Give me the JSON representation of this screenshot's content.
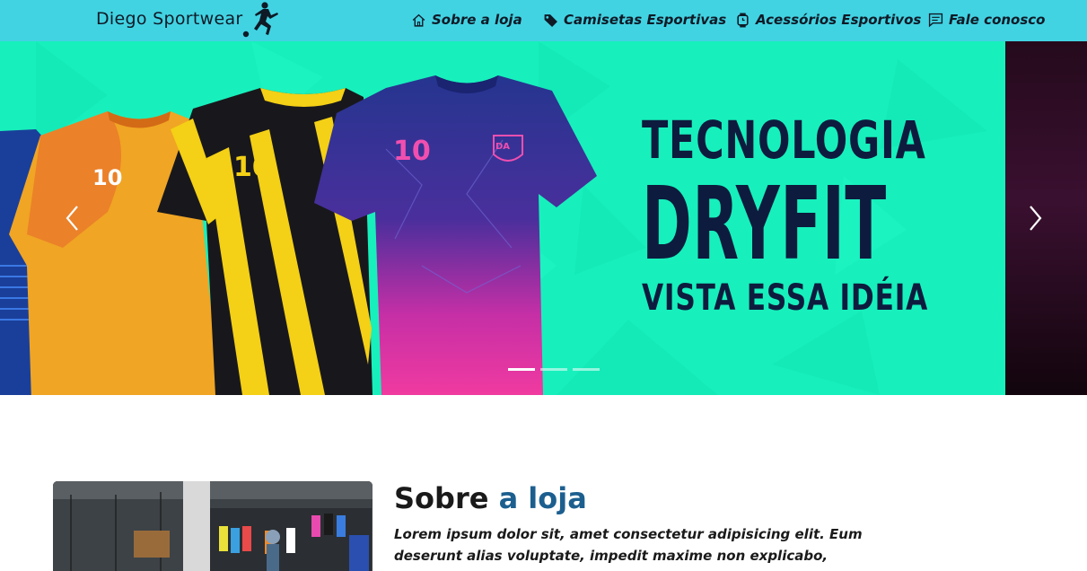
{
  "navbar": {
    "brand": "Diego Sportwear",
    "brand_logo_icon": "soccer-player-icon",
    "items": [
      {
        "label": "Sobre a loja",
        "icon": "house-icon"
      },
      {
        "label": "Camisetas Esportivas",
        "icon": "tag-icon"
      },
      {
        "label": "Acessórios Esportivos",
        "icon": "smartwatch-icon"
      },
      {
        "label": "Fale conosco",
        "icon": "chat-icon"
      }
    ]
  },
  "carousel": {
    "headline_1": "TECNOLOGIA",
    "headline_2": "DRYFIT",
    "headline_3": "VISTA ESSA IDÉIA",
    "jersey_numbers": [
      "10",
      "10",
      "10"
    ],
    "jersey_badge": "DA",
    "slide_count": 3,
    "active_slide": 1
  },
  "about": {
    "title_part1": "Sobre",
    "title_part2": "a loja",
    "text": "Lorem ipsum dolor sit, amet consectetur adipisicing elit. Eum deserunt alias voluptate, impedit maxime non explicabo, blanditiis"
  },
  "colors": {
    "navbar_bg": "#42d3e3",
    "slide_bg": "#17f0bc",
    "headline": "#0d1b3e",
    "accent": "#1c5f8f"
  }
}
